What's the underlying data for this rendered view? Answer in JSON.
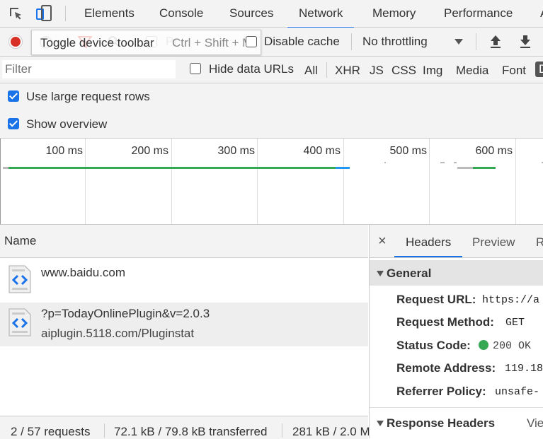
{
  "tabs": [
    {
      "label": "Elements"
    },
    {
      "label": "Console"
    },
    {
      "label": "Sources"
    },
    {
      "label": "Network"
    },
    {
      "label": "Memory"
    },
    {
      "label": "Performance"
    },
    {
      "label": "A"
    }
  ],
  "toolbar": {
    "tooltip": "Toggle device toolbar",
    "shortcut": "Ctrl + Shift + M",
    "preserve_log_hint": "Pr",
    "disable_cache_label": "Disable cache",
    "throttling_value": "No throttling"
  },
  "filterbar": {
    "filter_placeholder": "Filter",
    "hide_data_urls_label": "Hide data URLs",
    "types": [
      "All",
      "XHR",
      "JS",
      "CSS",
      "Img",
      "Media",
      "Font",
      "D"
    ]
  },
  "options": {
    "large_rows_label": "Use large request rows",
    "show_overview_label": "Show overview"
  },
  "overview": {
    "ticks": [
      "100 ms",
      "200 ms",
      "300 ms",
      "400 ms",
      "500 ms",
      "600 ms"
    ]
  },
  "requests": {
    "column_name": "Name",
    "rows": [
      {
        "name": "www.baidu.com",
        "sub": ""
      },
      {
        "name": "?p=TodayOnlinePlugin&v=2.0.3",
        "sub": "aiplugin.5118.com/Pluginstat"
      }
    ]
  },
  "status": {
    "requests": "2 / 57 requests",
    "transferred": "72.1 kB / 79.8 kB transferred",
    "resources": "281 kB / 2.0 M"
  },
  "details": {
    "tabs": [
      "Headers",
      "Preview",
      "R"
    ],
    "general_title": "General",
    "general": [
      {
        "key": "Request URL:",
        "value": "https://a"
      },
      {
        "key": "Request Method:",
        "value": "GET"
      },
      {
        "key": "Status Code:",
        "value": "200 OK"
      },
      {
        "key": "Remote Address:",
        "value": "119.18"
      },
      {
        "key": "Referrer Policy:",
        "value": "unsafe-"
      }
    ],
    "response_headers_title": "Response Headers",
    "view_source": "Vie"
  },
  "colors": {
    "accent": "#1a73e8",
    "record": "#d93025",
    "status_ok": "#34a853",
    "waterfall_green": "#34a853",
    "waterfall_blue": "#2196f3"
  }
}
